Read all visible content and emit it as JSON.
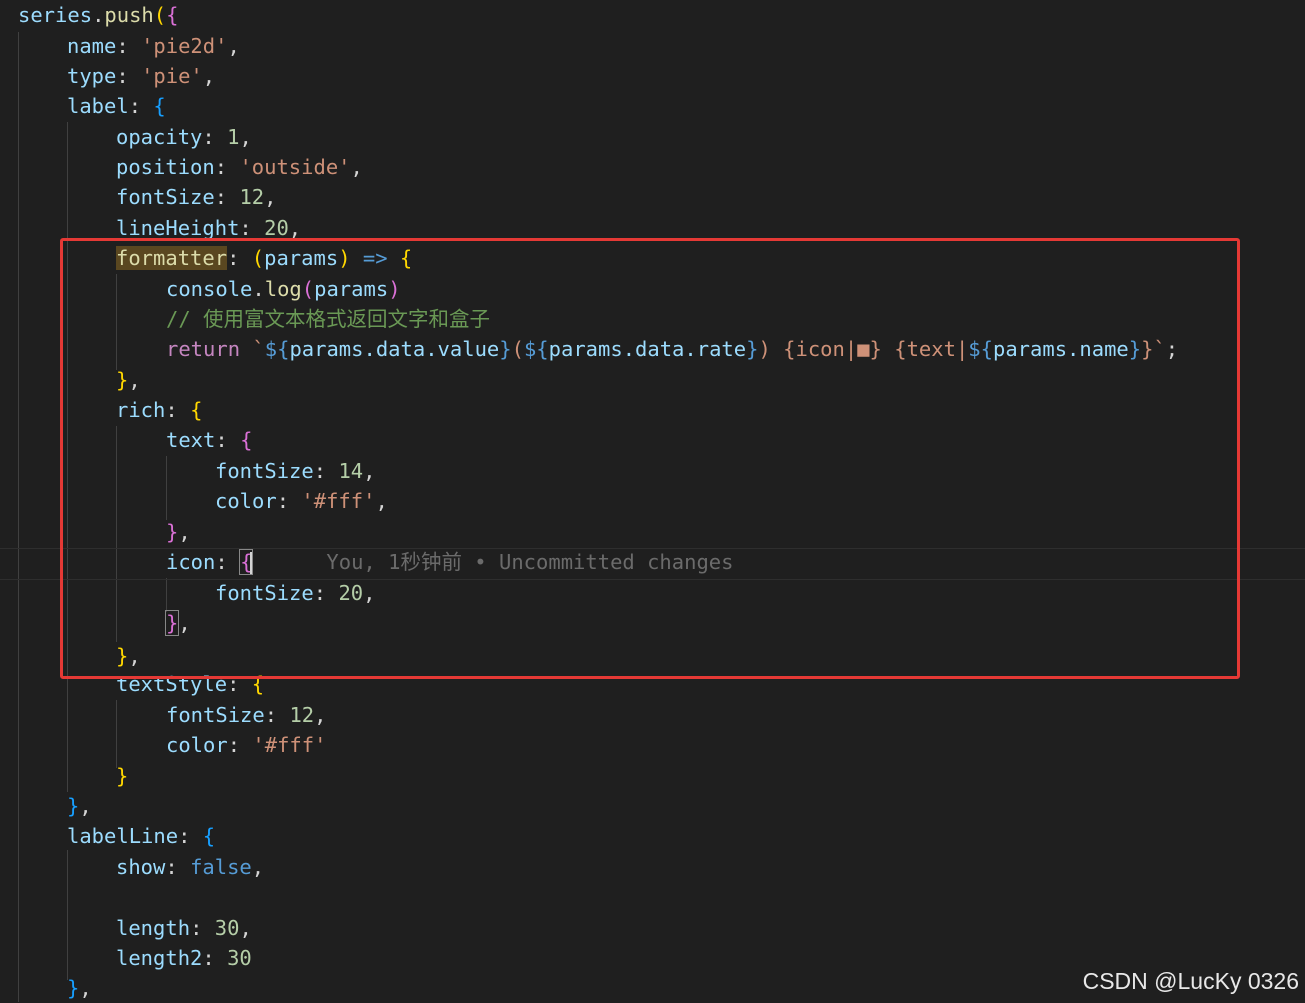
{
  "code": {
    "l1": {
      "a": "series",
      "b": ".",
      "c": "push",
      "d": "(",
      "e": "{"
    },
    "l2": {
      "k": "name",
      "p": ": ",
      "v": "'pie2d'",
      "c": ","
    },
    "l3": {
      "k": "type",
      "p": ": ",
      "v": "'pie'",
      "c": ","
    },
    "l4": {
      "k": "label",
      "p": ": ",
      "b": "{"
    },
    "l5": {
      "k": "opacity",
      "p": ": ",
      "v": "1",
      "c": ","
    },
    "l6": {
      "k": "position",
      "p": ": ",
      "v": "'outside'",
      "c": ","
    },
    "l7": {
      "k": "fontSize",
      "p": ": ",
      "v": "12",
      "c": ","
    },
    "l8": {
      "k": "lineHeight",
      "p": ": ",
      "v": "20",
      "c": ","
    },
    "l9": {
      "k": "formatter",
      "p": ": ",
      "o": "(",
      "arg": "params",
      "cl": ")",
      "arrow": " => ",
      "b": "{"
    },
    "l10": {
      "a": "console",
      "b": ".",
      "c": "log",
      "o": "(",
      "arg": "params",
      "cl": ")"
    },
    "l11": {
      "t": "// 使用富文本格式返回文字和盒子"
    },
    "l12": {
      "kw": "return",
      "sp": " ",
      "bt": "`",
      "d1": "${",
      "e1": "params.data.value",
      "c1": "}",
      "s1": "(",
      "d2": "${",
      "e2": "params.data.rate",
      "c2": "}",
      "s2": ") {icon|■} {text|",
      "d3": "${",
      "e3": "params.name",
      "c3": "}",
      "s3": "}",
      "bt2": "`",
      "semi": ";"
    },
    "l13": {
      "b": "}",
      "c": ","
    },
    "l14": {
      "k": "rich",
      "p": ": ",
      "b": "{"
    },
    "l15": {
      "k": "text",
      "p": ": ",
      "b": "{"
    },
    "l16": {
      "k": "fontSize",
      "p": ": ",
      "v": "14",
      "c": ","
    },
    "l17": {
      "k": "color",
      "p": ": ",
      "v": "'#fff'",
      "c": ","
    },
    "l18": {
      "b": "}",
      "c": ","
    },
    "l19": {
      "k": "icon",
      "p": ": ",
      "b": "{",
      "blame": "You, 1秒钟前 • Uncommitted changes"
    },
    "l20": {
      "k": "fontSize",
      "p": ": ",
      "v": "20",
      "c": ","
    },
    "l21": {
      "b": "}",
      "c": ","
    },
    "l22": {
      "b": "}",
      "c": ","
    },
    "l23": {
      "k": "textStyle",
      "p": ": ",
      "b": "{"
    },
    "l24": {
      "k": "fontSize",
      "p": ": ",
      "v": "12",
      "c": ","
    },
    "l25": {
      "k": "color",
      "p": ": ",
      "v": "'#fff'"
    },
    "l26": {
      "b": "}"
    },
    "l27": {
      "b": "}",
      "c": ","
    },
    "l28": {
      "k": "labelLine",
      "p": ": ",
      "b": "{"
    },
    "l29": {
      "k": "show",
      "p": ": ",
      "v": "false",
      "c": ","
    },
    "l30": {},
    "l31": {
      "k": "length",
      "p": ": ",
      "v": "30",
      "c": ","
    },
    "l32": {
      "k": "length2",
      "p": ": ",
      "v": "30"
    },
    "l33": {
      "b": "}",
      "c": ","
    }
  },
  "watermark": "CSDN @LucKy 0326",
  "colors": {
    "background": "#1f1f1f",
    "highlight_box": "#e53935",
    "property": "#9cdcfe",
    "string": "#ce9178",
    "number": "#b5cea8",
    "comment": "#6a9955",
    "keyword": "#c586c0"
  }
}
